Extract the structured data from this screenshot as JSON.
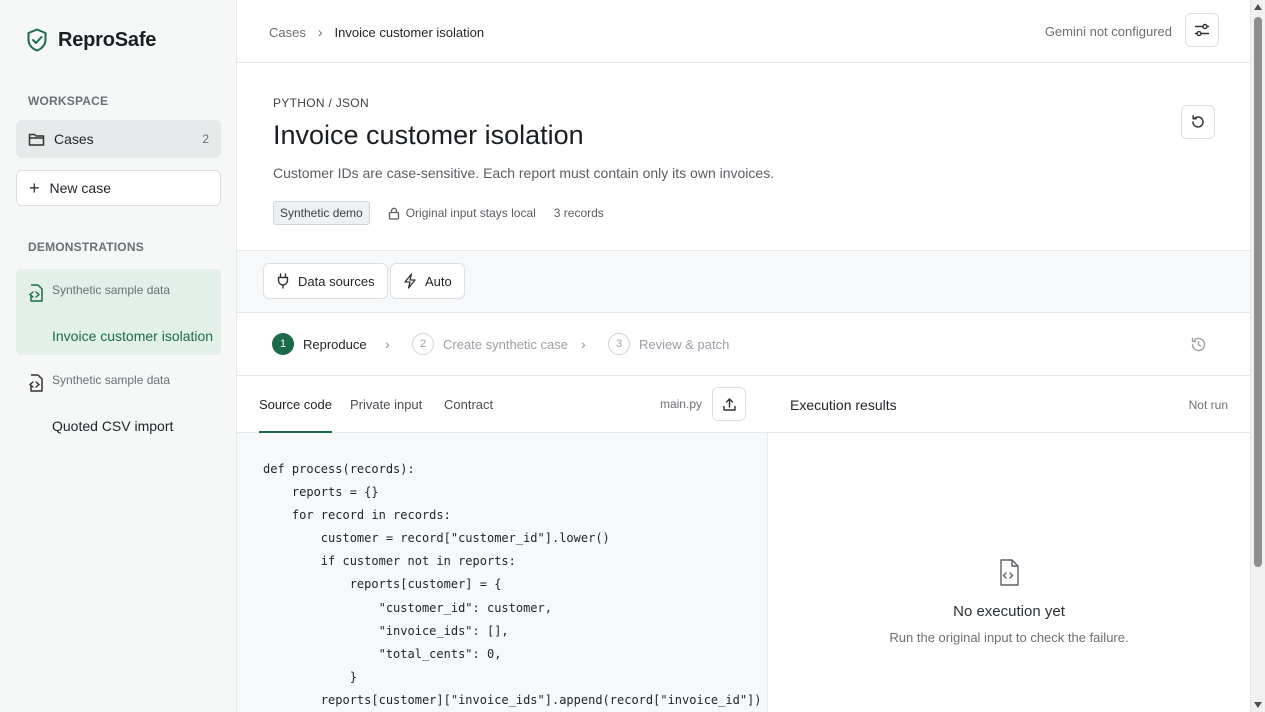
{
  "app": {
    "name": "ReproSafe",
    "accent": "#1b6b4a"
  },
  "sidebar": {
    "workspace_label": "WORKSPACE",
    "cases": {
      "label": "Cases",
      "count": "2"
    },
    "new_case": {
      "label": "New case"
    },
    "demonstrations_label": "DEMONSTRATIONS",
    "demos": [
      {
        "title": "Invoice customer isolation",
        "subtitle": "Synthetic sample data",
        "active": true
      },
      {
        "title": "Quoted CSV import",
        "subtitle": "Synthetic sample data",
        "active": false
      }
    ]
  },
  "topbar": {
    "breadcrumb": [
      "Cases",
      "Invoice customer isolation"
    ],
    "gemini_status": "Gemini not configured"
  },
  "header": {
    "language": "PYTHON / JSON",
    "title": "Invoice customer isolation",
    "description": "Customer IDs are case-sensitive. Each report must contain only its own invoices.",
    "badge": "Synthetic demo",
    "privacy": "Original input stays local",
    "records": "3 records"
  },
  "toolbar": {
    "data_sources": "Data sources",
    "auto": "Auto"
  },
  "steps": [
    {
      "num": "1",
      "label": "Reproduce",
      "active": true
    },
    {
      "num": "2",
      "label": "Create synthetic case",
      "active": false
    },
    {
      "num": "3",
      "label": "Review & patch",
      "active": false
    }
  ],
  "editor": {
    "tabs": [
      "Source code",
      "Private input",
      "Contract"
    ],
    "active_tab": "Source code",
    "filename": "main.py",
    "code_lines": [
      "def process(records):",
      "    reports = {}",
      "    for record in records:",
      "        customer = record[\"customer_id\"].lower()",
      "        if customer not in reports:",
      "            reports[customer] = {",
      "                \"customer_id\": customer,",
      "                \"invoice_ids\": [],",
      "                \"total_cents\": 0,",
      "            }",
      "        reports[customer][\"invoice_ids\"].append(record[\"invoice_id\"])"
    ]
  },
  "results": {
    "title": "Execution results",
    "status": "Not run",
    "empty_title": "No execution yet",
    "empty_subtitle": "Run the original input to check the failure."
  }
}
